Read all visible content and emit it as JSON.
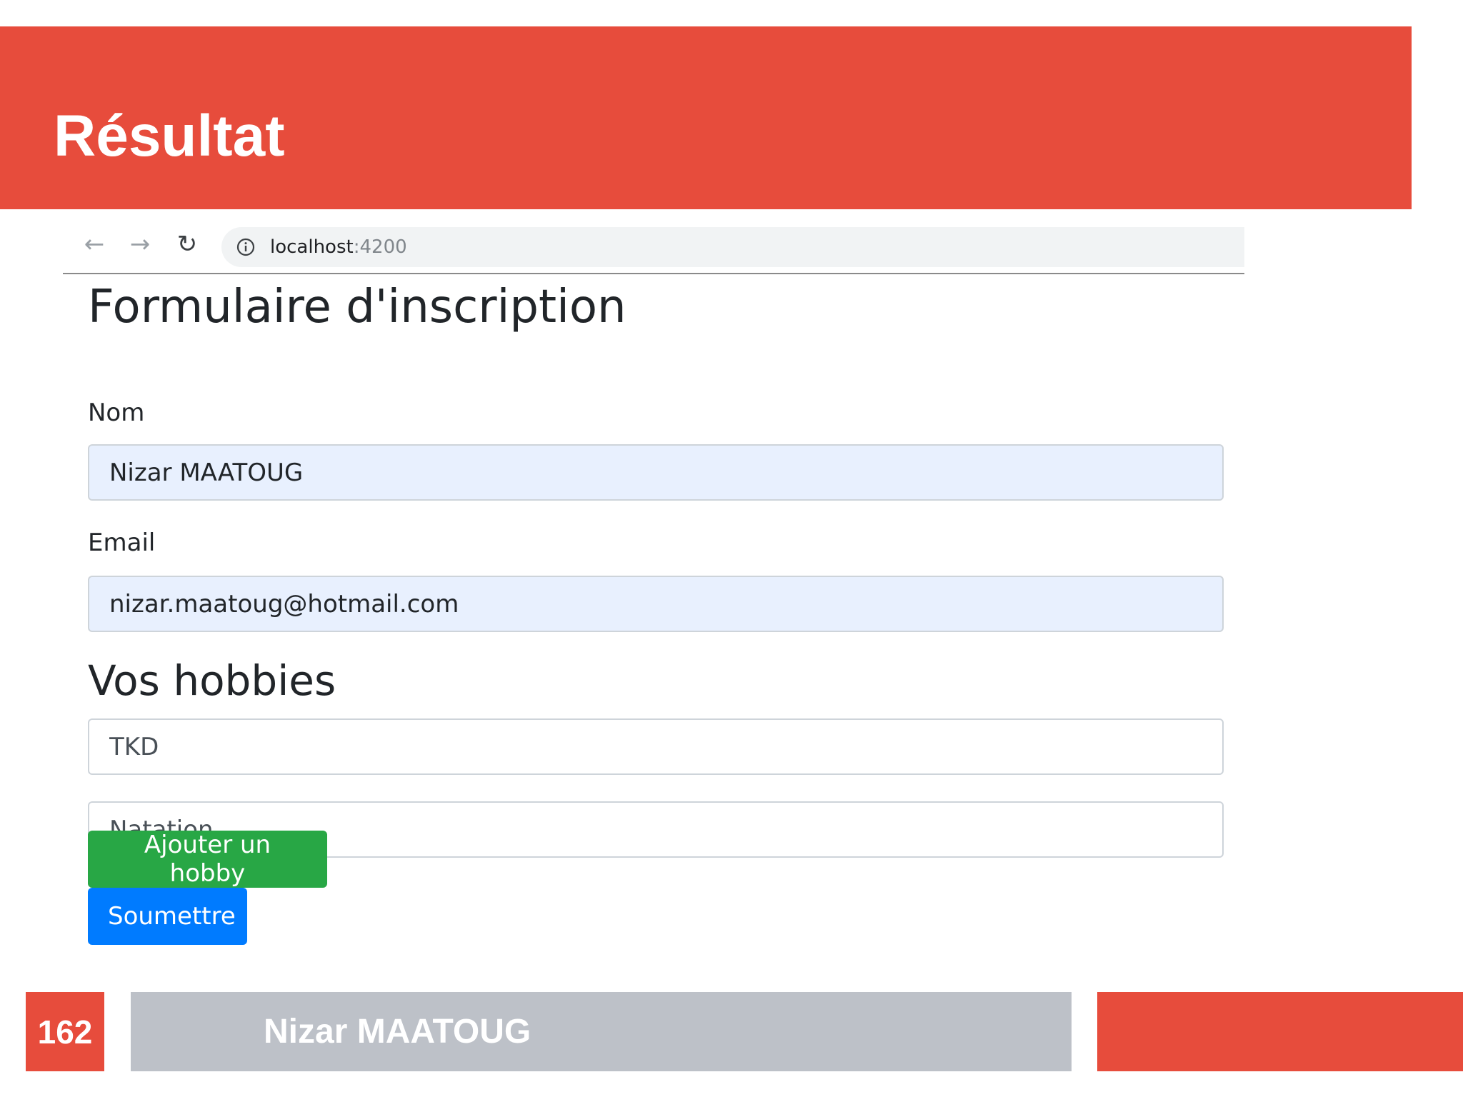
{
  "slide": {
    "title": "Résultat",
    "page_number": "162",
    "author": "Nizar MAATOUG",
    "accent_color": "#e74c3c",
    "footer_gray": "#bdc1c8"
  },
  "browser": {
    "back_icon": "arrow-left-icon",
    "forward_icon": "arrow-right-icon",
    "reload_icon": "reload-icon",
    "info_icon": "info-icon",
    "url_host": "localhost",
    "url_port": ":4200"
  },
  "form": {
    "title": "Formulaire d'inscription",
    "nom_label": "Nom",
    "nom_value": "Nizar MAATOUG",
    "email_label": "Email",
    "email_value": "nizar.maatoug@hotmail.com",
    "hobbies_title": "Vos hobbies",
    "hobbies": [
      "TKD",
      "Natation"
    ],
    "add_hobby_button": "Ajouter un hobby",
    "submit_button": "Soumettre",
    "success_color": "#28a745",
    "primary_color": "#007bff",
    "autofill_color": "#e8f0fe"
  }
}
